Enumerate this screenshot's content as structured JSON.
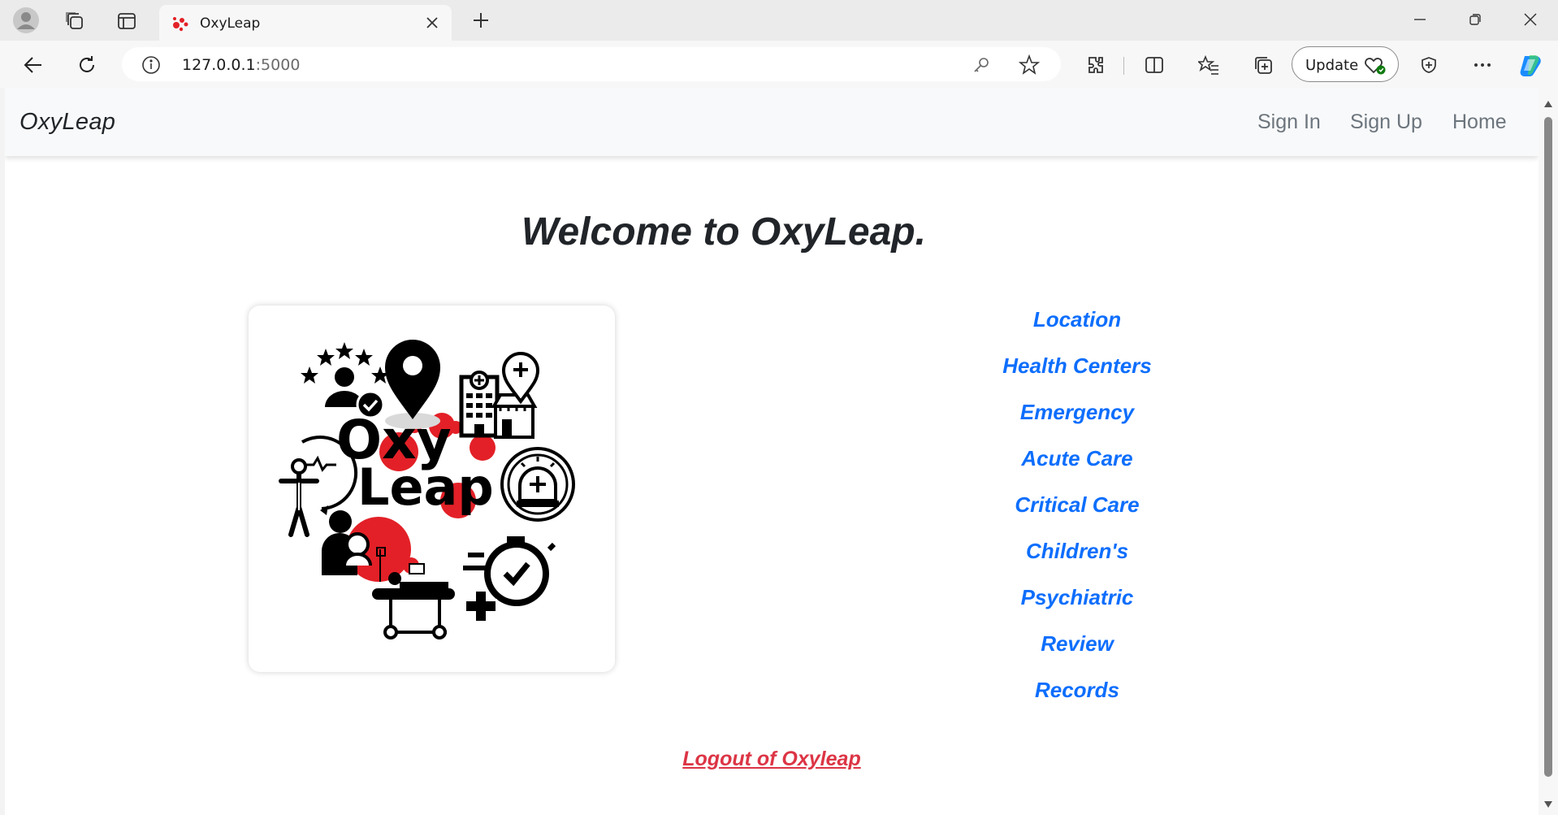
{
  "browser": {
    "tab_title": "OxyLeap",
    "url_host": "127.0.0.1",
    "url_port": ":5000",
    "update_label": "Update"
  },
  "site": {
    "brand": "OxyLeap",
    "nav": [
      {
        "label": "Sign In"
      },
      {
        "label": "Sign Up"
      },
      {
        "label": "Home"
      }
    ],
    "welcome": "Welcome to OxyLeap.",
    "logo_text": [
      "Oxy",
      "Leap"
    ],
    "links": [
      {
        "label": "Location"
      },
      {
        "label": "Health Centers"
      },
      {
        "label": "Emergency"
      },
      {
        "label": "Acute Care"
      },
      {
        "label": "Critical Care"
      },
      {
        "label": "Children's"
      },
      {
        "label": "Psychiatric"
      },
      {
        "label": "Review"
      },
      {
        "label": "Records"
      }
    ],
    "logout": "Logout of Oxyleap"
  },
  "colors": {
    "link": "#0d6efd",
    "logout": "#dc3545",
    "logo_red": "#e32027"
  }
}
